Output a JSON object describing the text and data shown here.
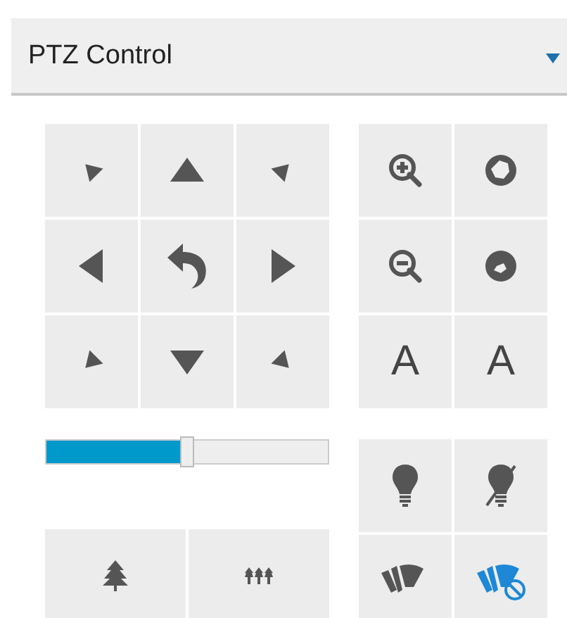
{
  "panel": {
    "title": "PTZ Control",
    "expanded": true
  },
  "direction_pad": [
    {
      "kind": "up-left"
    },
    {
      "kind": "up"
    },
    {
      "kind": "up-right"
    },
    {
      "kind": "left"
    },
    {
      "kind": "home"
    },
    {
      "kind": "right"
    },
    {
      "kind": "down-left"
    },
    {
      "kind": "down"
    },
    {
      "kind": "down-right"
    }
  ],
  "lens_buttons": [
    {
      "kind": "zoom-in"
    },
    {
      "kind": "iris-open"
    },
    {
      "kind": "zoom-out"
    },
    {
      "kind": "iris-close"
    },
    {
      "kind": "text",
      "label": "A"
    },
    {
      "kind": "text",
      "label": "A"
    }
  ],
  "speed_slider": {
    "level": 0.48
  },
  "scene_buttons": [
    {
      "kind": "tree"
    },
    {
      "kind": "trees"
    }
  ],
  "aux_buttons": [
    {
      "kind": "light",
      "active": false
    },
    {
      "kind": "light-off",
      "active": false
    },
    {
      "kind": "wiper",
      "active": false
    },
    {
      "kind": "wiper-off",
      "active": true
    }
  ]
}
